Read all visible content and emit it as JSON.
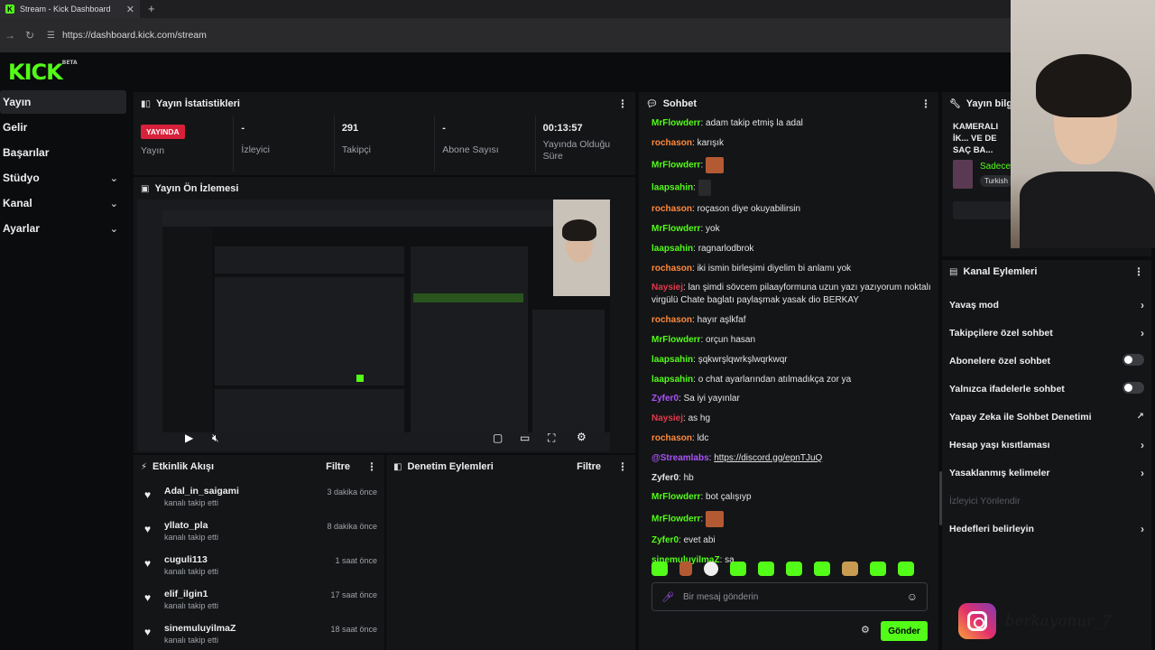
{
  "browser": {
    "tab_title": "Stream - Kick Dashboard",
    "url": "https://dashboard.kick.com/stream"
  },
  "logo": {
    "text": "KICK",
    "badge": "BETA"
  },
  "sidebar": {
    "items": [
      {
        "label": "Yayın",
        "expandable": false,
        "active": true
      },
      {
        "label": "Gelir",
        "expandable": false
      },
      {
        "label": "Başarılar",
        "expandable": false
      },
      {
        "label": "Stüdyo",
        "expandable": true
      },
      {
        "label": "Kanal",
        "expandable": true
      },
      {
        "label": "Ayarlar",
        "expandable": true
      }
    ]
  },
  "stats_panel": {
    "title": "Yayın İstatistikleri",
    "live_badge": "YAYINDA",
    "stats": [
      {
        "value": "",
        "label": "Yayın"
      },
      {
        "value": "-",
        "label": "İzleyici"
      },
      {
        "value": "291",
        "label": "Takipçi"
      },
      {
        "value": "-",
        "label": "Abone Sayısı"
      },
      {
        "value": "00:13:57",
        "label": "Yayında Olduğu Süre"
      }
    ]
  },
  "preview_panel": {
    "title": "Yayın Ön İzlemesi"
  },
  "activity_feed": {
    "title": "Etkinlik Akışı",
    "filter": "Filtre",
    "items": [
      {
        "name": "Adal_in_saigami",
        "action": "kanalı takip etti",
        "time": "3 dakika önce"
      },
      {
        "name": "yllato_pla",
        "action": "kanalı takip etti",
        "time": "8 dakika önce"
      },
      {
        "name": "cuguli113",
        "action": "kanalı takip etti",
        "time": "1 saat önce"
      },
      {
        "name": "elif_ilgin1",
        "action": "kanalı takip etti",
        "time": "17 saat önce"
      },
      {
        "name": "sinemuluyilmaZ",
        "action": "kanalı takip etti",
        "time": "18 saat önce"
      }
    ]
  },
  "moderation_panel": {
    "title": "Denetim Eylemleri",
    "filter": "Filtre"
  },
  "chat": {
    "title": "Sohbet",
    "messages": [
      {
        "user": "MrFlowderr",
        "color": "#53fc18",
        "text": "adam takip etmiş la adal"
      },
      {
        "user": "rochason",
        "color": "#ff8a3d",
        "text": "karışık"
      },
      {
        "user": "MrFlowderr",
        "color": "#53fc18",
        "text": "",
        "emote": "emote"
      },
      {
        "user": "laapsahin",
        "color": "#53fc18",
        "text": "",
        "emote": "dark"
      },
      {
        "user": "rochason",
        "color": "#ff8a3d",
        "text": "roçason diye okuyabilirsin"
      },
      {
        "user": "MrFlowderr",
        "color": "#53fc18",
        "text": "yok"
      },
      {
        "user": "laapsahin",
        "color": "#53fc18",
        "text": "ragnarlodbrok"
      },
      {
        "user": "rochason",
        "color": "#ff8a3d",
        "text": "iki ismin birleşimi diyelim bi anlamı yok"
      },
      {
        "user": "Naysiej",
        "color": "#e0394b",
        "text": "lan şimdi sövcem pilaayformuna uzun yazı yazıyorum noktalı virgülü Chate baglatı paylaşmak yasak dio BERKAY"
      },
      {
        "user": "rochason",
        "color": "#ff8a3d",
        "text": "hayır aşlkfaf"
      },
      {
        "user": "MrFlowderr",
        "color": "#53fc18",
        "text": "orçun hasan"
      },
      {
        "user": "laapsahin",
        "color": "#53fc18",
        "text": "şqkwrşlqwrkşlwqrkwqr"
      },
      {
        "user": "laapsahin",
        "color": "#53fc18",
        "text": "o chat ayarlarından atılmadıkça zor ya"
      },
      {
        "user": "Zyfer0",
        "color": "#a855f7",
        "text": "Sa iyi yayınlar"
      },
      {
        "user": "Naysiej",
        "color": "#e0394b",
        "text": "as hg"
      },
      {
        "user": "rochason",
        "color": "#ff8a3d",
        "text": "ldc"
      },
      {
        "user": "@Streamlabs",
        "color": "#a855f7",
        "text": "https://discord.gg/epnTJuQ"
      },
      {
        "user": "Zyfer0",
        "color": "#e5e5e5",
        "text": "hb"
      },
      {
        "user": "MrFlowderr",
        "color": "#53fc18",
        "text": "bot çalışıyp"
      },
      {
        "user": "MrFlowderr",
        "color": "#53fc18",
        "text": "",
        "emote": "emote"
      },
      {
        "user": "Zyfer0",
        "color": "#53fc18",
        "text": "evet abi"
      },
      {
        "user": "sinemuluyilmaZ",
        "color": "#53fc18",
        "text": "sa"
      }
    ],
    "input_placeholder": "Bir mesaj gönderin",
    "send_label": "Gönder"
  },
  "stream_info": {
    "title": "Yayın bilgisi",
    "stream_title": "KAMERALI İK... VE DE SAÇ BA...",
    "sub": "Sadece",
    "tag": "Turkish"
  },
  "channel_actions": {
    "title": "Kanal Eylemleri",
    "items": [
      {
        "label": "Yavaş mod",
        "control": "chevron"
      },
      {
        "label": "Takipçilere özel sohbet",
        "control": "chevron"
      },
      {
        "label": "Abonelere özel sohbet",
        "control": "toggle"
      },
      {
        "label": "Yalnızca ifadelerle sohbet",
        "control": "toggle"
      },
      {
        "label": "Yapay Zeka ile Sohbet Denetimi",
        "control": "external"
      },
      {
        "label": "Hesap yaşı kısıtlaması",
        "control": "chevron"
      },
      {
        "label": "Yasaklanmış kelimeler",
        "control": "chevron"
      },
      {
        "label": "İzleyici Yönlendir",
        "control": "none",
        "disabled": true
      },
      {
        "label": "Hedefleri belirleyin",
        "control": "chevron"
      }
    ]
  },
  "overlay": {
    "instagram_handle": "berkayonur_7"
  }
}
